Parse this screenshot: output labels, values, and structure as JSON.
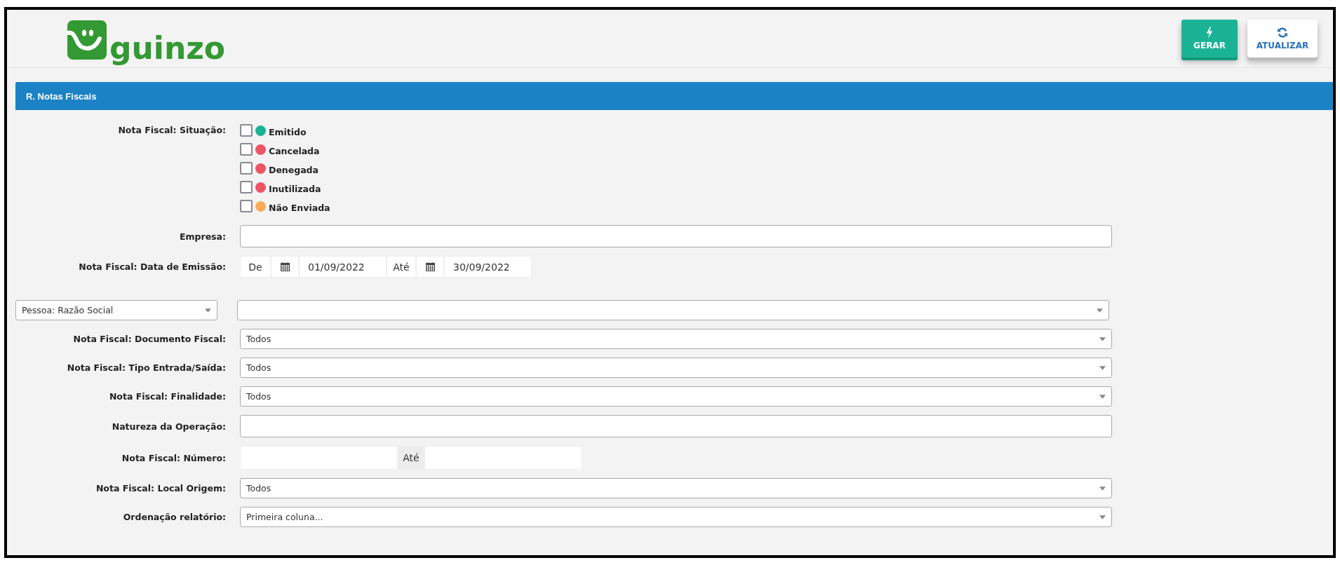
{
  "logo": {
    "text": "guinzo"
  },
  "actions": [
    {
      "kind": "generate",
      "label": "GERAR"
    },
    {
      "kind": "refresh",
      "label": "ATUALIZAR"
    }
  ],
  "panel": {
    "title": "R. Notas Fiscais"
  },
  "fields": [
    {
      "kind": "checkboxes",
      "label": "Nota Fiscal: Situação:",
      "options": [
        {
          "label": "Emitido",
          "checked": false,
          "color": "#1ab394"
        },
        {
          "label": "Cancelada",
          "checked": false,
          "color": "#ed5565"
        },
        {
          "label": "Denegada",
          "checked": false,
          "color": "#ed5565"
        },
        {
          "label": "Inutilizada",
          "checked": false,
          "color": "#ed5565"
        },
        {
          "label": "Não Enviada",
          "checked": false,
          "color": "#f8ac59"
        }
      ]
    },
    {
      "kind": "text",
      "label": "Empresa:"
    },
    {
      "kind": "daterange",
      "label": "Nota Fiscal: Data de Emissão:",
      "from_label": "De",
      "from": "01/09/2022",
      "to_label": "Até",
      "to": "30/09/2022"
    },
    {
      "kind": "selectpair",
      "selector": "Pessoa: Razão Social"
    },
    {
      "kind": "select",
      "label": "Nota Fiscal: Documento Fiscal:",
      "value": "Todos"
    },
    {
      "kind": "select",
      "label": "Nota Fiscal: Tipo Entrada/Saída:",
      "value": "Todos"
    },
    {
      "kind": "select",
      "label": "Nota Fiscal: Finalidade:",
      "value": "Todos"
    },
    {
      "kind": "text",
      "label": "Natureza da Operação:"
    },
    {
      "kind": "numberrange",
      "label": "Nota Fiscal: Número:",
      "to_label": "Até"
    },
    {
      "kind": "select",
      "label": "Nota Fiscal: Local Origem:",
      "value": "Todos"
    },
    {
      "kind": "select",
      "label": "Ordenação relatório:",
      "value": "Primeira coluna..."
    }
  ]
}
